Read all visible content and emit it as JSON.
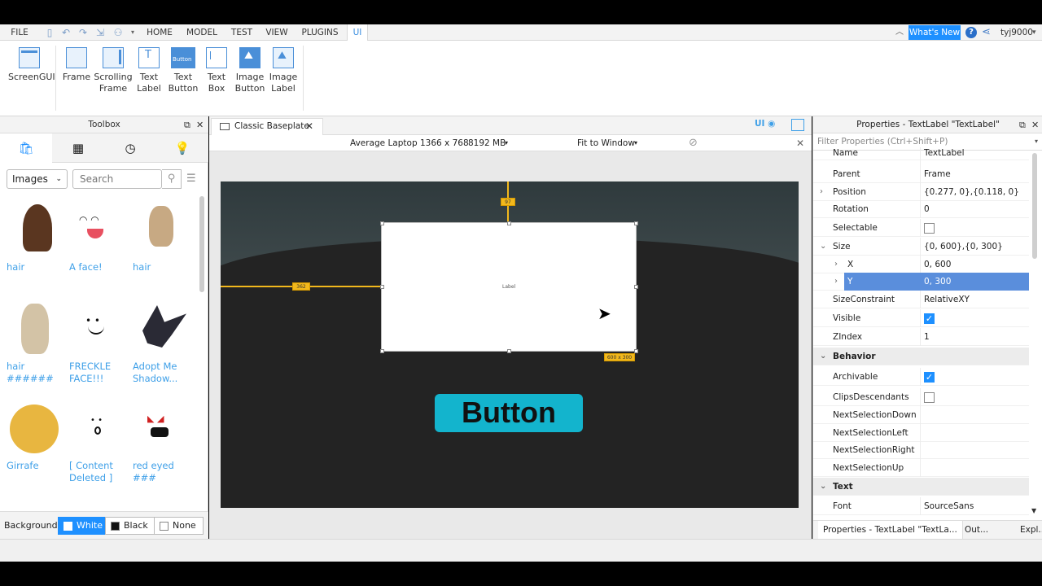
{
  "menubar": {
    "file": "FILE",
    "tabs": [
      "HOME",
      "MODEL",
      "TEST",
      "VIEW",
      "PLUGINS",
      "UI"
    ],
    "active_tab": "UI",
    "whats_new": "What's New",
    "username": "tyj9000"
  },
  "ribbon": {
    "screen_gui": "ScreenGUI",
    "items": [
      {
        "line1": "Frame",
        "line2": ""
      },
      {
        "line1": "Scrolling",
        "line2": "Frame"
      },
      {
        "line1": "Text",
        "line2": "Label"
      },
      {
        "line1": "Text",
        "line2": "Button"
      },
      {
        "line1": "Text",
        "line2": "Box"
      },
      {
        "line1": "Image",
        "line2": "Button"
      },
      {
        "line1": "Image",
        "line2": "Label"
      }
    ],
    "text_button_icon_label": "Button"
  },
  "toolbox": {
    "title": "Toolbox",
    "category": "Images",
    "search_placeholder": "Search",
    "items": [
      {
        "label": "hair",
        "icon": "brown-hair-icon"
      },
      {
        "label": "A face!",
        "icon": "smile-face-icon"
      },
      {
        "label": "hair",
        "icon": "blonde-hair-icon"
      },
      {
        "label": "hair ######",
        "icon": "braided-hair-icon"
      },
      {
        "label": "FRECKLE FACE!!!",
        "icon": "freckle-face-icon"
      },
      {
        "label": "Adopt Me Shadow...",
        "icon": "shadow-dragon-icon"
      },
      {
        "label": "Girrafe",
        "icon": "giraffe-icon"
      },
      {
        "label": "[ Content Deleted ]",
        "icon": "surprised-face-icon"
      },
      {
        "label": "red eyed ###",
        "icon": "red-eyed-face-icon"
      }
    ],
    "background_label": "Background:",
    "bg_options": [
      "White",
      "Black",
      "None"
    ],
    "bg_selected": "White"
  },
  "viewport": {
    "doc_tab": "Classic Baseplate",
    "ui_toggle": "UI",
    "device": "Average Laptop",
    "resolution": "1366 x 768",
    "memory": "8192 MB",
    "fit": "Fit to Window",
    "frame_text": "Label",
    "guide_top": "97",
    "guide_left": "362",
    "size_tag": "600 x 300",
    "button_text": "Button"
  },
  "properties": {
    "title": "Properties - TextLabel \"TextLabel\"",
    "filter_placeholder": "Filter Properties (Ctrl+Shift+P)",
    "rows": [
      {
        "name": "Name",
        "value": "TextLabel"
      },
      {
        "name": "Parent",
        "value": "Frame"
      },
      {
        "name": "Position",
        "value": "{0.277, 0},{0.118, 0}"
      },
      {
        "name": "Rotation",
        "value": "0"
      },
      {
        "name": "Selectable",
        "value": ""
      },
      {
        "name": "Size",
        "value": "{0, 600},{0, 300}"
      },
      {
        "name": "X",
        "value": "0, 600"
      },
      {
        "name": "Y",
        "value": "0, 300"
      },
      {
        "name": "SizeConstraint",
        "value": "RelativeXY"
      },
      {
        "name": "Visible",
        "value": ""
      },
      {
        "name": "ZIndex",
        "value": "1"
      },
      {
        "name": "Behavior",
        "value": ""
      },
      {
        "name": "Archivable",
        "value": ""
      },
      {
        "name": "ClipsDescendants",
        "value": ""
      },
      {
        "name": "NextSelectionDown",
        "value": ""
      },
      {
        "name": "NextSelectionLeft",
        "value": ""
      },
      {
        "name": "NextSelectionRight",
        "value": ""
      },
      {
        "name": "NextSelectionUp",
        "value": ""
      },
      {
        "name": "Text",
        "value": ""
      },
      {
        "name": "Font",
        "value": "SourceSans"
      }
    ],
    "bottom_tabs": [
      "Properties - TextLabel \"TextLa...",
      "Out...",
      "Expl..."
    ]
  },
  "colors": {
    "accent": "#1e90ff",
    "guide": "#f2b81c",
    "button_fill": "#13b4cd",
    "selected_row": "#5a8edc"
  }
}
